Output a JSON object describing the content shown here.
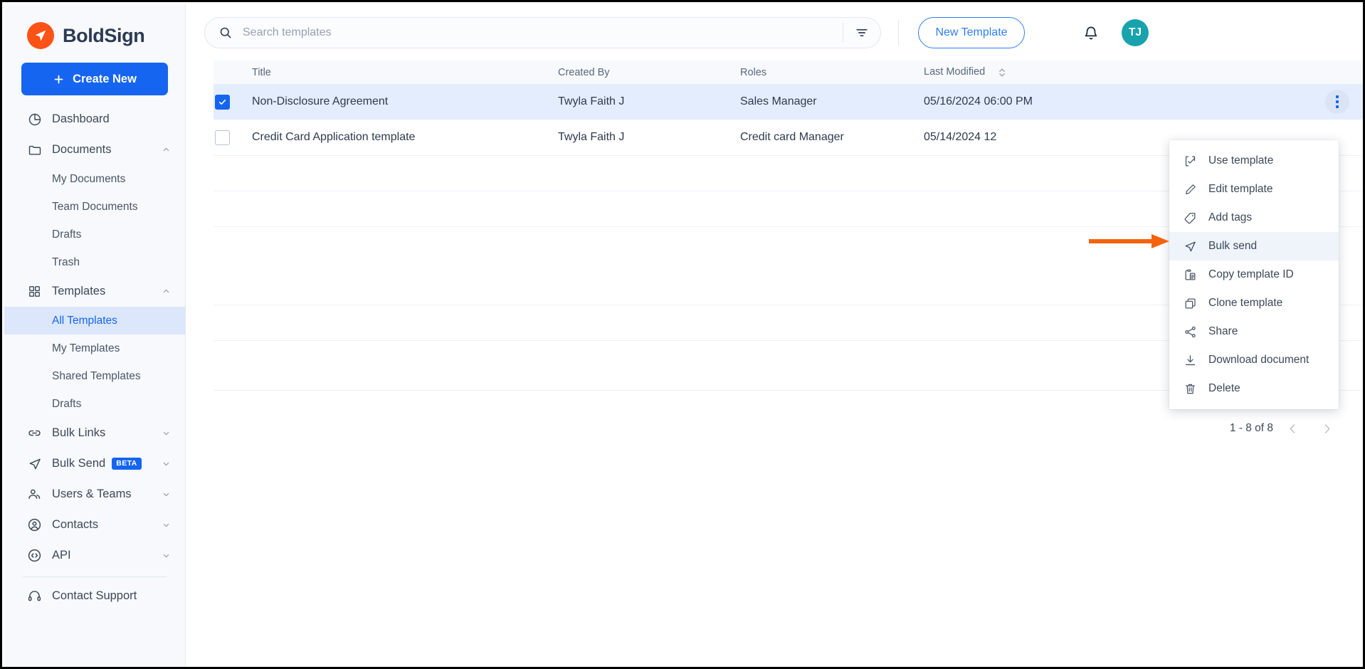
{
  "brand": {
    "name": "BoldSign",
    "logo_icon": "boldsign-paper-plane-icon",
    "accent": "#ff5216"
  },
  "sidebar": {
    "create_new_label": "Create New",
    "items": [
      {
        "label": "Dashboard",
        "icon": "pie-chart-icon",
        "expandable": false
      },
      {
        "label": "Documents",
        "icon": "folder-icon",
        "expandable": true,
        "expanded": true
      },
      {
        "label": "Templates",
        "icon": "grid-icon",
        "expandable": true,
        "expanded": true
      },
      {
        "label": "Bulk Links",
        "icon": "link-icon",
        "expandable": true,
        "expanded": false
      },
      {
        "label": "Bulk Send",
        "icon": "send-icon",
        "expandable": true,
        "expanded": false,
        "badge": "BETA"
      },
      {
        "label": "Users & Teams",
        "icon": "users-icon",
        "expandable": true,
        "expanded": false
      },
      {
        "label": "Contacts",
        "icon": "contact-circle-icon",
        "expandable": true,
        "expanded": false
      },
      {
        "label": "API",
        "icon": "code-circle-icon",
        "expandable": true,
        "expanded": false
      }
    ],
    "documents_children": [
      {
        "label": "My Documents",
        "active": false
      },
      {
        "label": "Team Documents",
        "active": false
      },
      {
        "label": "Drafts",
        "active": false
      },
      {
        "label": "Trash",
        "active": false
      }
    ],
    "templates_children": [
      {
        "label": "All Templates",
        "active": true
      },
      {
        "label": "My Templates",
        "active": false
      },
      {
        "label": "Shared Templates",
        "active": false
      },
      {
        "label": "Drafts",
        "active": false
      }
    ],
    "support_label": "Contact Support",
    "support_icon": "headset-icon",
    "active_color": "#1565f0"
  },
  "header": {
    "search": {
      "placeholder": "Search templates",
      "value": "",
      "icon": "search-icon"
    },
    "filter_icon": "filter-icon",
    "new_template_label": "New Template",
    "notifications_icon": "bell-icon",
    "avatar_initials": "TJ",
    "avatar_color": "#17a3ac"
  },
  "table": {
    "columns": [
      {
        "key": "title",
        "label": "Title",
        "sortable": false
      },
      {
        "key": "created_by",
        "label": "Created By",
        "sortable": false
      },
      {
        "key": "roles",
        "label": "Roles",
        "sortable": false
      },
      {
        "key": "last_modified",
        "label": "Last Modified",
        "sortable": true
      }
    ],
    "rows": [
      {
        "title": "Non-Disclosure Agreement",
        "created_by": "Twyla Faith J",
        "roles": "Sales Manager",
        "last_modified": "05/16/2024 06:00 PM",
        "selected": true
      },
      {
        "title": "Credit Card Application template",
        "created_by": "Twyla Faith J",
        "roles": "Credit card Manager",
        "last_modified": "05/14/2024 12",
        "selected": false
      }
    ]
  },
  "context_menu": {
    "items": [
      {
        "label": "Use template",
        "icon": "checked-square-bracket-icon",
        "highlighted": false
      },
      {
        "label": "Edit template",
        "icon": "pencil-icon",
        "highlighted": false
      },
      {
        "label": "Add tags",
        "icon": "tag-icon",
        "highlighted": false
      },
      {
        "label": "Bulk send",
        "icon": "send-icon",
        "highlighted": true
      },
      {
        "label": "Copy template ID",
        "icon": "clipboard-copy-icon",
        "highlighted": false
      },
      {
        "label": "Clone template",
        "icon": "copy-icon",
        "highlighted": false
      },
      {
        "label": "Share",
        "icon": "share-nodes-icon",
        "highlighted": false
      },
      {
        "label": "Download document",
        "icon": "download-icon",
        "highlighted": false
      },
      {
        "label": "Delete",
        "icon": "trash-icon",
        "highlighted": false
      }
    ]
  },
  "annotation": {
    "arrow_color": "#f4630c",
    "points_to": "Bulk send"
  },
  "pagination": {
    "range_label": "1 - 8 of 8",
    "prev_icon": "chevron-left-icon",
    "next_icon": "chevron-right-icon"
  }
}
